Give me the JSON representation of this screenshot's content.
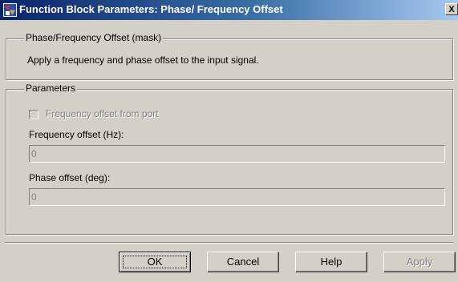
{
  "window": {
    "title": "Function Block Parameters: Phase/ Frequency Offset",
    "close_glyph": "X",
    "icon": "simulink-block-icon"
  },
  "mask_group": {
    "legend": "Phase/Frequency Offset (mask)",
    "description": "Apply a frequency and phase offset to the input signal."
  },
  "params_group": {
    "legend": "Parameters",
    "freq_from_port": {
      "label": "Frequency offset from port",
      "checked": false,
      "enabled": false
    },
    "freq_offset": {
      "label": "Frequency offset (Hz):",
      "value": "0",
      "enabled": false
    },
    "phase_offset": {
      "label": "Phase offset (deg):",
      "value": "0",
      "enabled": false
    }
  },
  "buttons": {
    "ok": "OK",
    "cancel": "Cancel",
    "help": "Help",
    "apply": "Apply"
  }
}
